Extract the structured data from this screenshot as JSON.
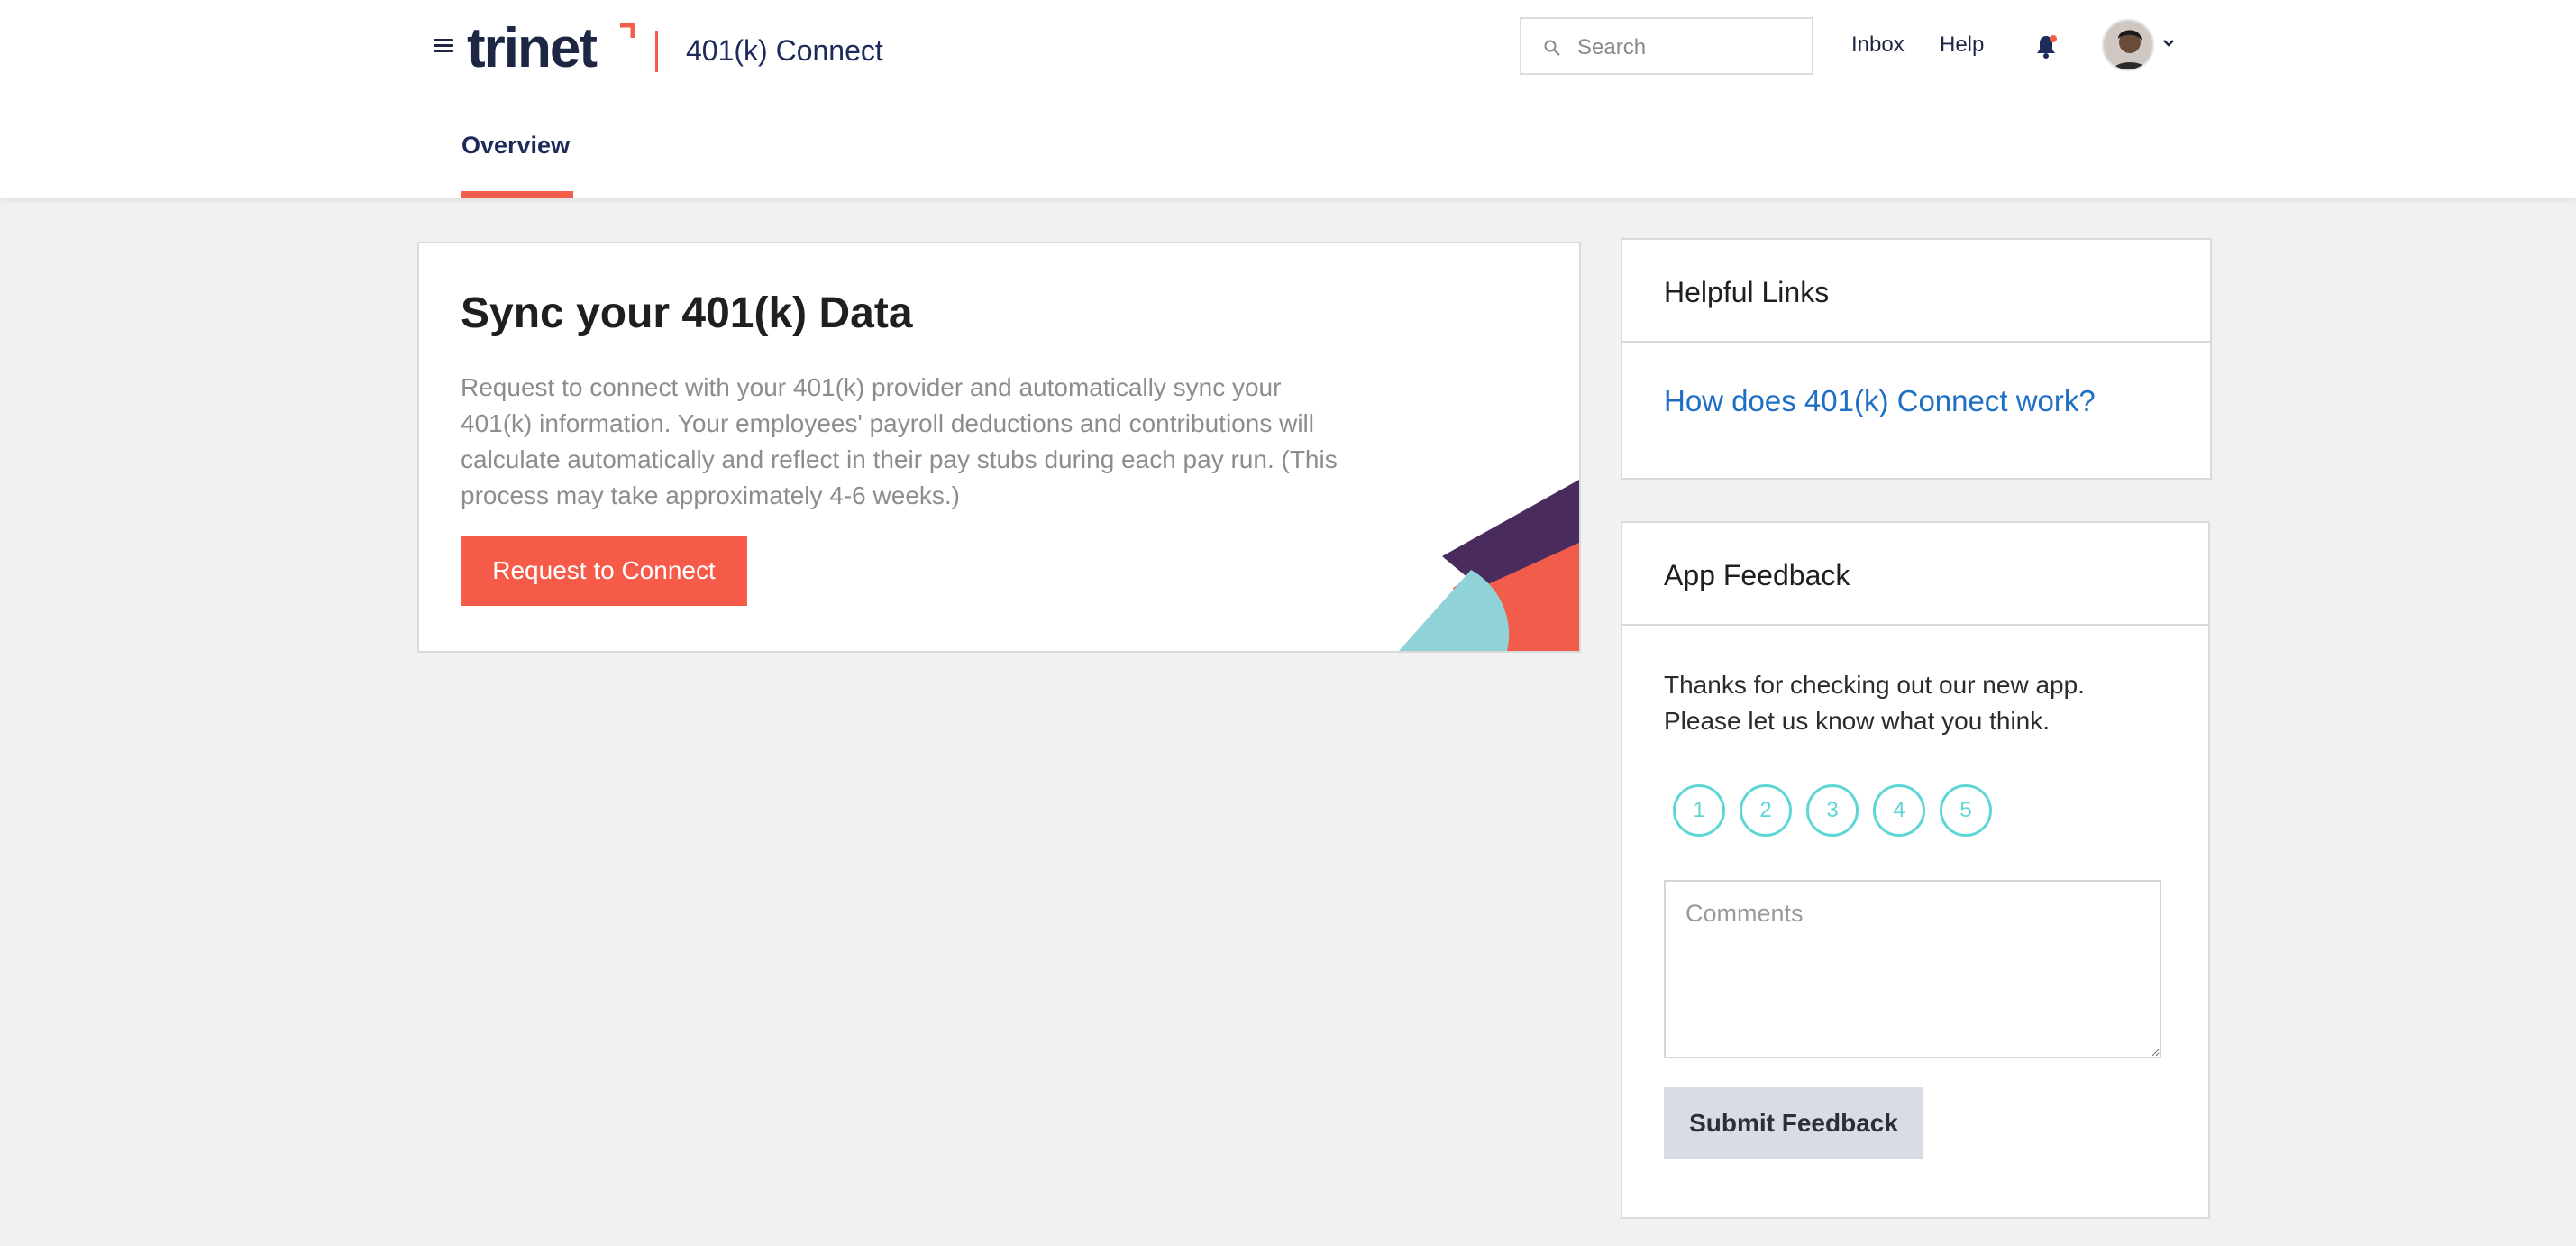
{
  "header": {
    "logo_text": "trinet",
    "app_title": "401(k) Connect",
    "search": {
      "placeholder": "Search",
      "value": ""
    },
    "nav": {
      "inbox": "Inbox",
      "help": "Help"
    },
    "icons": {
      "menu": "hamburger-icon",
      "search": "search-icon",
      "notifications": "bell-icon",
      "notification_dot_color": "#f25c4b",
      "account": "chevron-down-icon"
    }
  },
  "tabs": [
    {
      "label": "Overview",
      "active": true
    }
  ],
  "sync_card": {
    "title": "Sync your 401(k) Data",
    "description": "Request to connect with your 401(k) provider and automatically sync your 401(k) information.  Your employees' payroll deductions and contributions will calculate automatically and reflect in their pay stubs during each pay run. (This process may take approximately 4-6 weeks.)",
    "button_label": "Request to Connect"
  },
  "helpful_links": {
    "title": "Helpful Links",
    "links": [
      "How does 401(k) Connect work?"
    ]
  },
  "app_feedback": {
    "title": "App Feedback",
    "line1": "Thanks for checking out our new app.",
    "line2": "Please let us know what you think.",
    "ratings": [
      "1",
      "2",
      "3",
      "4",
      "5"
    ],
    "comments_placeholder": "Comments",
    "comments_value": "",
    "submit_label": "Submit Feedback"
  },
  "colors": {
    "accent": "#f55b48",
    "link": "#1f6fc5",
    "brand_navy": "#1d2a5a",
    "rating": "#5fd6d6",
    "deco_purple": "#4a2b5e",
    "deco_teal": "#8fd3d9"
  }
}
